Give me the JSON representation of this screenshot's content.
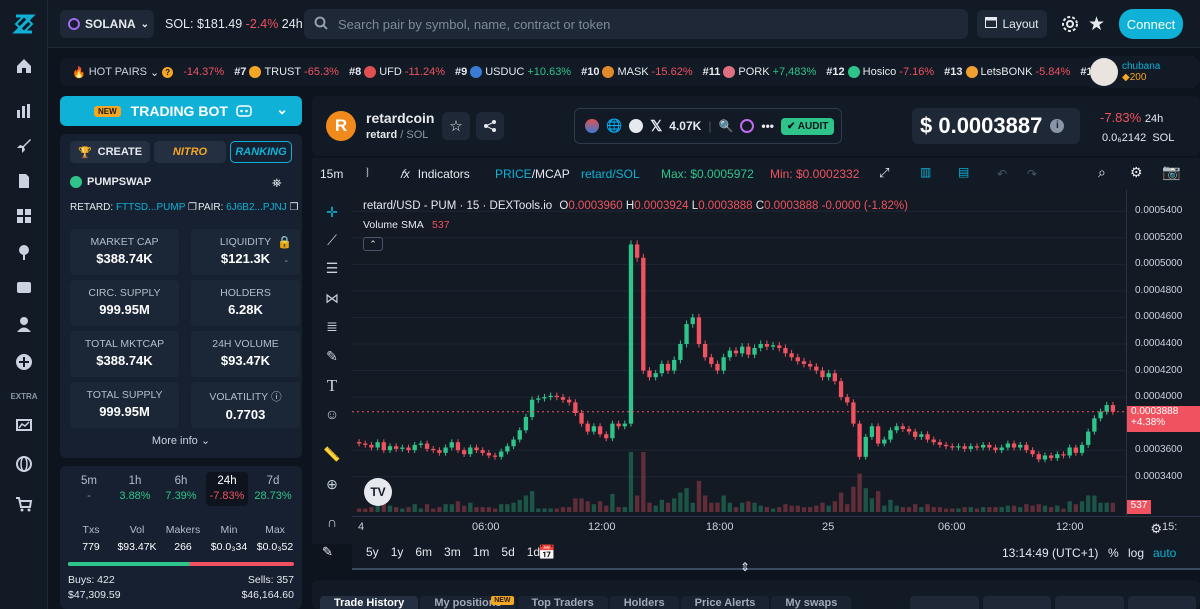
{
  "topbar": {
    "chain": "SOLANA",
    "sol_label": "SOL:",
    "sol_price": "$181.49",
    "sol_change": "-2.4%",
    "sol_period": "24h",
    "search_placeholder": "Search pair by symbol, name, contract or token",
    "layout": "Layout",
    "connect": "Connect"
  },
  "sidebar": {
    "extra": "EXTRA"
  },
  "ticker": {
    "label": "HOT PAIRS",
    "first_change": "-14.37%",
    "items": [
      {
        "rank": "#7",
        "name": "TRUST",
        "change": "-65.3%",
        "color": "#f5a623",
        "dir": "down"
      },
      {
        "rank": "#8",
        "name": "UFD",
        "change": "-11.24%",
        "color": "#e05050",
        "dir": "down"
      },
      {
        "rank": "#9",
        "name": "USDUC",
        "change": "+10.63%",
        "color": "#3a7bd5",
        "dir": "up"
      },
      {
        "rank": "#10",
        "name": "MASK",
        "change": "-15.62%",
        "color": "#e08a2a",
        "dir": "down"
      },
      {
        "rank": "#11",
        "name": "PORK",
        "change": "+7,483%",
        "color": "#e07080",
        "dir": "up"
      },
      {
        "rank": "#12",
        "name": "Hosico",
        "change": "-7.16%",
        "color": "#2fc58a",
        "dir": "down"
      },
      {
        "rank": "#13",
        "name": "LetsBONK",
        "change": "-5.84%",
        "color": "#f0a030",
        "dir": "down"
      }
    ],
    "tail": "#1",
    "user": "chubana",
    "points": "200"
  },
  "bot": {
    "badge": "NEW",
    "label": "TRADING BOT"
  },
  "info": {
    "tab_create": "CREATE",
    "tab_nitro": "NITRO",
    "tab_ranking": "RANKING",
    "dex": "PUMPSWAP",
    "retard_label": "RETARD:",
    "retard_addr": "FTTSD...PUMP",
    "pair_label": "PAIR:",
    "pair_addr": "6J6B2...PJNJ",
    "metrics": [
      {
        "label": "MARKET CAP",
        "value": "$388.74K"
      },
      {
        "label": "LIQUIDITY",
        "value": "$121.3K"
      },
      {
        "label": "CIRC. SUPPLY",
        "value": "999.95M"
      },
      {
        "label": "HOLDERS",
        "value": "6.28K"
      },
      {
        "label": "TOTAL MKTCAP",
        "value": "$388.74K"
      },
      {
        "label": "24H VOLUME",
        "value": "$93.47K"
      },
      {
        "label": "TOTAL SUPPLY",
        "value": "999.95M"
      },
      {
        "label": "VOLATILITY",
        "value": "0.7703"
      }
    ],
    "liq_dash": "-",
    "more": "More info"
  },
  "stats": {
    "periods": [
      {
        "t": "5m",
        "v": "-"
      },
      {
        "t": "1h",
        "v": "3.88%"
      },
      {
        "t": "6h",
        "v": "7.39%"
      },
      {
        "t": "24h",
        "v": "-7.83%"
      },
      {
        "t": "7d",
        "v": "28.73%"
      }
    ],
    "cols": [
      {
        "t": "Txs",
        "v": "779"
      },
      {
        "t": "Vol",
        "v": "$93.47K"
      },
      {
        "t": "Makers",
        "v": "266"
      },
      {
        "t": "Min",
        "v": "$0.0₃34"
      },
      {
        "t": "Max",
        "v": "$0.0₃52"
      }
    ],
    "buys": "Buys: 422",
    "buys_val": "$47,309.59",
    "sells": "Sells: 357",
    "sells_val": "$46,164.60",
    "buy_ratio": 0.54
  },
  "token": {
    "name": "retardcoin",
    "symbol": "retard",
    "chain": "SOL",
    "followers": "4.07K",
    "audit": "AUDIT",
    "price": "$ 0.0003887",
    "change": "-7.83%",
    "period": "24h",
    "sol_price": "0.0₆2142",
    "sol_unit": "SOL"
  },
  "toolbar": {
    "interval": "15m",
    "indicators": "Indicators",
    "price": "PRICE",
    "mcap": "/MCAP",
    "pair": "retard/SOL",
    "max": "Max: $0.0005972",
    "min": "Min: $0.0002332"
  },
  "chart": {
    "title": "retard/USD - PUM · 15 · DEXTools.io",
    "o": "0.0003960",
    "h": "0.0003924",
    "l": "0.0003888",
    "c": "0.0003888",
    "chg": "-0.0000 (-1.82%)",
    "vol_label": "Volume SMA",
    "vol_val": "537",
    "cur_price": "0.0003888",
    "cur_chg": "+4.38%",
    "vol_badge": "537"
  },
  "chart_data": {
    "type": "candlestick",
    "y_ticks": [
      "0.0005400",
      "0.0005200",
      "0.0005000",
      "0.0004800",
      "0.0004600",
      "0.0004400",
      "0.0004200",
      "0.0004000",
      "0.0003600",
      "0.0003400"
    ],
    "x_ticks": [
      "4",
      "06:00",
      "12:00",
      "18:00",
      "25",
      "06:00",
      "12:00",
      "15:"
    ],
    "ylim": [
      0.00033,
      0.00055
    ],
    "close": [
      0.000365,
      0.000364,
      0.000362,
      0.000366,
      0.00036,
      0.000363,
      0.000361,
      0.000362,
      0.00036,
      0.000364,
      0.000365,
      0.000361,
      0.00036,
      0.000358,
      0.000362,
      0.000366,
      0.00036,
      0.000357,
      0.000362,
      0.00036,
      0.000358,
      0.000356,
      0.000355,
      0.000359,
      0.000363,
      0.000368,
      0.000375,
      0.000385,
      0.000398,
      0.000399,
      0.0004,
      0.000401,
      0.0004,
      0.000398,
      0.000396,
      0.000388,
      0.00038,
      0.000374,
      0.000378,
      0.000372,
      0.000369,
      0.00038,
      0.000378,
      0.00038,
      0.000515,
      0.000505,
      0.00042,
      0.000415,
      0.000418,
      0.000425,
      0.00042,
      0.000428,
      0.00044,
      0.000455,
      0.00046,
      0.00044,
      0.00043,
      0.000425,
      0.00042,
      0.00043,
      0.000435,
      0.000433,
      0.000438,
      0.000432,
      0.000437,
      0.00044,
      0.000438,
      0.000439,
      0.000437,
      0.000433,
      0.00043,
      0.000427,
      0.000425,
      0.000423,
      0.00042,
      0.000415,
      0.000418,
      0.000412,
      0.0004,
      0.000396,
      0.00038,
      0.000355,
      0.00037,
      0.000378,
      0.000365,
      0.000368,
      0.000375,
      0.000378,
      0.000376,
      0.000374,
      0.00037,
      0.000372,
      0.000368,
      0.000366,
      0.000364,
      0.000363,
      0.000362,
      0.000363,
      0.000361,
      0.000363,
      0.000362,
      0.000364,
      0.000362,
      0.00036,
      0.000362,
      0.000365,
      0.000362,
      0.000364,
      0.00036,
      0.000357,
      0.000353,
      0.000356,
      0.000354,
      0.000357,
      0.000356,
      0.000362,
      0.000358,
      0.000364,
      0.000374,
      0.000384,
      0.000389,
      0.000394,
      0.000389
    ]
  },
  "range": {
    "items": [
      "5y",
      "1y",
      "6m",
      "3m",
      "1m",
      "5d",
      "1d"
    ],
    "time": "13:14:49 (UTC+1)",
    "pct": "%",
    "log": "log",
    "auto": "auto"
  },
  "bottom": {
    "tabs": [
      "Trade History",
      "My positions",
      "Top Traders",
      "Holders",
      "Price Alerts",
      "My swaps"
    ],
    "new": "NEW"
  }
}
